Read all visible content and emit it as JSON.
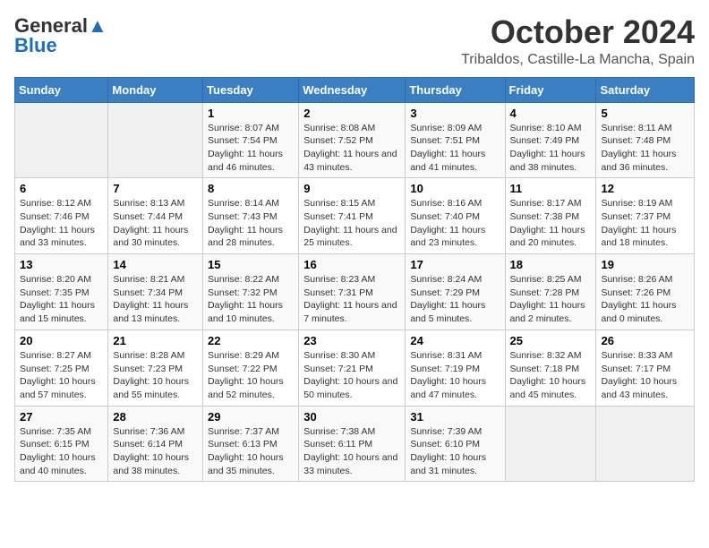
{
  "logo": {
    "line1": "General",
    "line2": "Blue"
  },
  "title": "October 2024",
  "location": "Tribaldos, Castille-La Mancha, Spain",
  "days_of_week": [
    "Sunday",
    "Monday",
    "Tuesday",
    "Wednesday",
    "Thursday",
    "Friday",
    "Saturday"
  ],
  "weeks": [
    [
      {
        "day": "",
        "info": ""
      },
      {
        "day": "",
        "info": ""
      },
      {
        "day": "1",
        "info": "Sunrise: 8:07 AM\nSunset: 7:54 PM\nDaylight: 11 hours and 46 minutes."
      },
      {
        "day": "2",
        "info": "Sunrise: 8:08 AM\nSunset: 7:52 PM\nDaylight: 11 hours and 43 minutes."
      },
      {
        "day": "3",
        "info": "Sunrise: 8:09 AM\nSunset: 7:51 PM\nDaylight: 11 hours and 41 minutes."
      },
      {
        "day": "4",
        "info": "Sunrise: 8:10 AM\nSunset: 7:49 PM\nDaylight: 11 hours and 38 minutes."
      },
      {
        "day": "5",
        "info": "Sunrise: 8:11 AM\nSunset: 7:48 PM\nDaylight: 11 hours and 36 minutes."
      }
    ],
    [
      {
        "day": "6",
        "info": "Sunrise: 8:12 AM\nSunset: 7:46 PM\nDaylight: 11 hours and 33 minutes."
      },
      {
        "day": "7",
        "info": "Sunrise: 8:13 AM\nSunset: 7:44 PM\nDaylight: 11 hours and 30 minutes."
      },
      {
        "day": "8",
        "info": "Sunrise: 8:14 AM\nSunset: 7:43 PM\nDaylight: 11 hours and 28 minutes."
      },
      {
        "day": "9",
        "info": "Sunrise: 8:15 AM\nSunset: 7:41 PM\nDaylight: 11 hours and 25 minutes."
      },
      {
        "day": "10",
        "info": "Sunrise: 8:16 AM\nSunset: 7:40 PM\nDaylight: 11 hours and 23 minutes."
      },
      {
        "day": "11",
        "info": "Sunrise: 8:17 AM\nSunset: 7:38 PM\nDaylight: 11 hours and 20 minutes."
      },
      {
        "day": "12",
        "info": "Sunrise: 8:19 AM\nSunset: 7:37 PM\nDaylight: 11 hours and 18 minutes."
      }
    ],
    [
      {
        "day": "13",
        "info": "Sunrise: 8:20 AM\nSunset: 7:35 PM\nDaylight: 11 hours and 15 minutes."
      },
      {
        "day": "14",
        "info": "Sunrise: 8:21 AM\nSunset: 7:34 PM\nDaylight: 11 hours and 13 minutes."
      },
      {
        "day": "15",
        "info": "Sunrise: 8:22 AM\nSunset: 7:32 PM\nDaylight: 11 hours and 10 minutes."
      },
      {
        "day": "16",
        "info": "Sunrise: 8:23 AM\nSunset: 7:31 PM\nDaylight: 11 hours and 7 minutes."
      },
      {
        "day": "17",
        "info": "Sunrise: 8:24 AM\nSunset: 7:29 PM\nDaylight: 11 hours and 5 minutes."
      },
      {
        "day": "18",
        "info": "Sunrise: 8:25 AM\nSunset: 7:28 PM\nDaylight: 11 hours and 2 minutes."
      },
      {
        "day": "19",
        "info": "Sunrise: 8:26 AM\nSunset: 7:26 PM\nDaylight: 11 hours and 0 minutes."
      }
    ],
    [
      {
        "day": "20",
        "info": "Sunrise: 8:27 AM\nSunset: 7:25 PM\nDaylight: 10 hours and 57 minutes."
      },
      {
        "day": "21",
        "info": "Sunrise: 8:28 AM\nSunset: 7:23 PM\nDaylight: 10 hours and 55 minutes."
      },
      {
        "day": "22",
        "info": "Sunrise: 8:29 AM\nSunset: 7:22 PM\nDaylight: 10 hours and 52 minutes."
      },
      {
        "day": "23",
        "info": "Sunrise: 8:30 AM\nSunset: 7:21 PM\nDaylight: 10 hours and 50 minutes."
      },
      {
        "day": "24",
        "info": "Sunrise: 8:31 AM\nSunset: 7:19 PM\nDaylight: 10 hours and 47 minutes."
      },
      {
        "day": "25",
        "info": "Sunrise: 8:32 AM\nSunset: 7:18 PM\nDaylight: 10 hours and 45 minutes."
      },
      {
        "day": "26",
        "info": "Sunrise: 8:33 AM\nSunset: 7:17 PM\nDaylight: 10 hours and 43 minutes."
      }
    ],
    [
      {
        "day": "27",
        "info": "Sunrise: 7:35 AM\nSunset: 6:15 PM\nDaylight: 10 hours and 40 minutes."
      },
      {
        "day": "28",
        "info": "Sunrise: 7:36 AM\nSunset: 6:14 PM\nDaylight: 10 hours and 38 minutes."
      },
      {
        "day": "29",
        "info": "Sunrise: 7:37 AM\nSunset: 6:13 PM\nDaylight: 10 hours and 35 minutes."
      },
      {
        "day": "30",
        "info": "Sunrise: 7:38 AM\nSunset: 6:11 PM\nDaylight: 10 hours and 33 minutes."
      },
      {
        "day": "31",
        "info": "Sunrise: 7:39 AM\nSunset: 6:10 PM\nDaylight: 10 hours and 31 minutes."
      },
      {
        "day": "",
        "info": ""
      },
      {
        "day": "",
        "info": ""
      }
    ]
  ]
}
